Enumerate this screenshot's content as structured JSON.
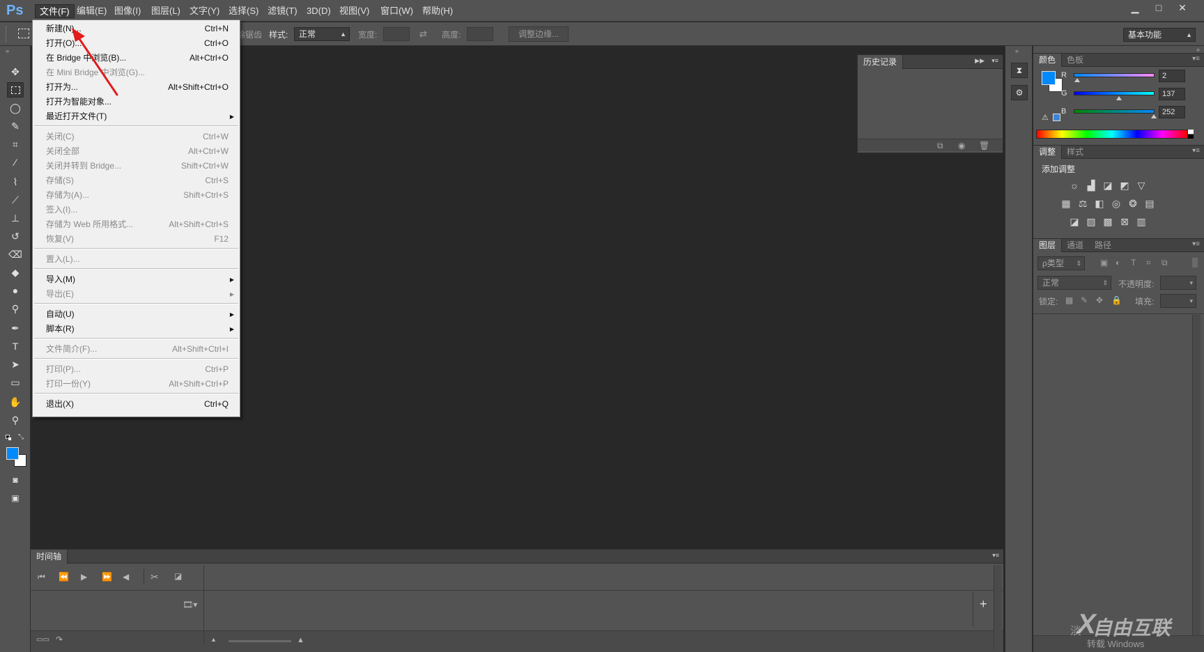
{
  "app": {
    "logo": "Ps"
  },
  "menubar": {
    "items": [
      "文件(F)",
      "编辑(E)",
      "图像(I)",
      "图层(L)",
      "文字(Y)",
      "选择(S)",
      "滤镜(T)",
      "3D(D)",
      "视图(V)",
      "窗口(W)",
      "帮助(H)"
    ],
    "active_index": 0
  },
  "window_controls": {
    "minimize": "▁",
    "maximize": "□",
    "close": "✕"
  },
  "options_bar": {
    "style_label": "样式:",
    "style_value": "正常",
    "width_label": "宽度:",
    "height_label": "高度:",
    "refine_edge_button": "调整边缘...",
    "workspace_value": "基本功能",
    "hidden_fragment": "消除锯齿"
  },
  "file_menu": {
    "items": [
      {
        "label": "新建(N)...",
        "shortcut": "Ctrl+N",
        "disabled": false,
        "submenu": false
      },
      {
        "label": "打开(O)...",
        "shortcut": "Ctrl+O",
        "disabled": false,
        "submenu": false
      },
      {
        "label": "在 Bridge 中浏览(B)...",
        "shortcut": "Alt+Ctrl+O",
        "disabled": false,
        "submenu": false
      },
      {
        "label": "在 Mini Bridge 中浏览(G)...",
        "shortcut": "",
        "disabled": true,
        "submenu": false
      },
      {
        "label": "打开为...",
        "shortcut": "Alt+Shift+Ctrl+O",
        "disabled": false,
        "submenu": false
      },
      {
        "label": "打开为智能对象...",
        "shortcut": "",
        "disabled": false,
        "submenu": false
      },
      {
        "label": "最近打开文件(T)",
        "shortcut": "",
        "disabled": false,
        "submenu": true
      },
      {
        "label": "关闭(C)",
        "shortcut": "Ctrl+W",
        "disabled": true,
        "submenu": false
      },
      {
        "label": "关闭全部",
        "shortcut": "Alt+Ctrl+W",
        "disabled": true,
        "submenu": false
      },
      {
        "label": "关闭并转到 Bridge...",
        "shortcut": "Shift+Ctrl+W",
        "disabled": true,
        "submenu": false
      },
      {
        "label": "存储(S)",
        "shortcut": "Ctrl+S",
        "disabled": true,
        "submenu": false
      },
      {
        "label": "存储为(A)...",
        "shortcut": "Shift+Ctrl+S",
        "disabled": true,
        "submenu": false
      },
      {
        "label": "签入(I)...",
        "shortcut": "",
        "disabled": true,
        "submenu": false
      },
      {
        "label": "存储为 Web 所用格式...",
        "shortcut": "Alt+Shift+Ctrl+S",
        "disabled": true,
        "submenu": false
      },
      {
        "label": "恢复(V)",
        "shortcut": "F12",
        "disabled": true,
        "submenu": false
      },
      {
        "label": "置入(L)...",
        "shortcut": "",
        "disabled": true,
        "submenu": false
      },
      {
        "label": "导入(M)",
        "shortcut": "",
        "disabled": false,
        "submenu": true
      },
      {
        "label": "导出(E)",
        "shortcut": "",
        "disabled": true,
        "submenu": true
      },
      {
        "label": "自动(U)",
        "shortcut": "",
        "disabled": false,
        "submenu": true
      },
      {
        "label": "脚本(R)",
        "shortcut": "",
        "disabled": false,
        "submenu": true
      },
      {
        "label": "文件简介(F)...",
        "shortcut": "Alt+Shift+Ctrl+I",
        "disabled": true,
        "submenu": false
      },
      {
        "label": "打印(P)...",
        "shortcut": "Ctrl+P",
        "disabled": true,
        "submenu": false
      },
      {
        "label": "打印一份(Y)",
        "shortcut": "Alt+Shift+Ctrl+P",
        "disabled": true,
        "submenu": false
      },
      {
        "label": "退出(X)",
        "shortcut": "Ctrl+Q",
        "disabled": false,
        "submenu": false
      }
    ]
  },
  "history_panel": {
    "title": "历史记录"
  },
  "color_panel": {
    "tabs": [
      "颜色",
      "色板"
    ],
    "r_label": "R",
    "g_label": "G",
    "b_label": "B",
    "r_value": "2",
    "g_value": "137",
    "b_value": "252",
    "foreground_color": "#0289fc"
  },
  "adjustments_panel": {
    "tabs": [
      "调整",
      "样式"
    ],
    "heading": "添加调整"
  },
  "layers_panel": {
    "tabs": [
      "图层",
      "通道",
      "路径"
    ],
    "filter_label": "ρ类型",
    "blend_mode": "正常",
    "opacity_label": "不透明度:",
    "lock_label": "锁定:",
    "fill_label": "填充:"
  },
  "timeline_panel": {
    "title": "时间轴"
  },
  "watermark": {
    "brand": "自由互联",
    "prefix": "X",
    "sub": "转载 Windows",
    "left_text": "淡"
  }
}
